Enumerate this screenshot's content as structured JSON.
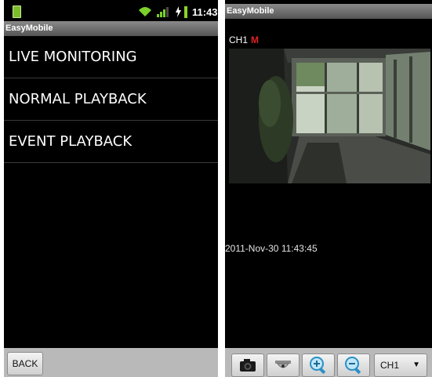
{
  "left_screen": {
    "status_bar": {
      "time": "11:43",
      "icons": [
        "sim-card-icon",
        "wifi-icon",
        "signal-icon",
        "charging-icon",
        "battery-icon"
      ]
    },
    "app_title": "EasyMobile",
    "menu": [
      {
        "label": "LIVE MONITORING"
      },
      {
        "label": "NORMAL PLAYBACK"
      },
      {
        "label": "EVENT PLAYBACK"
      }
    ],
    "back_label": "BACK"
  },
  "right_screen": {
    "app_title": "EasyMobile",
    "channel": "CH1",
    "mode": "M",
    "timestamp": "2011-Nov-30 11:43:45",
    "toolbar": {
      "icons": [
        "camera-icon",
        "ptz-dome-icon",
        "zoom-in-icon",
        "zoom-out-icon"
      ],
      "channel_select_value": "CH1"
    }
  },
  "colors": {
    "background": "#000000",
    "title_bar": "#6e6e6e",
    "bottom_bar": "#b9b9b9",
    "mode_indicator": "#e02222"
  }
}
